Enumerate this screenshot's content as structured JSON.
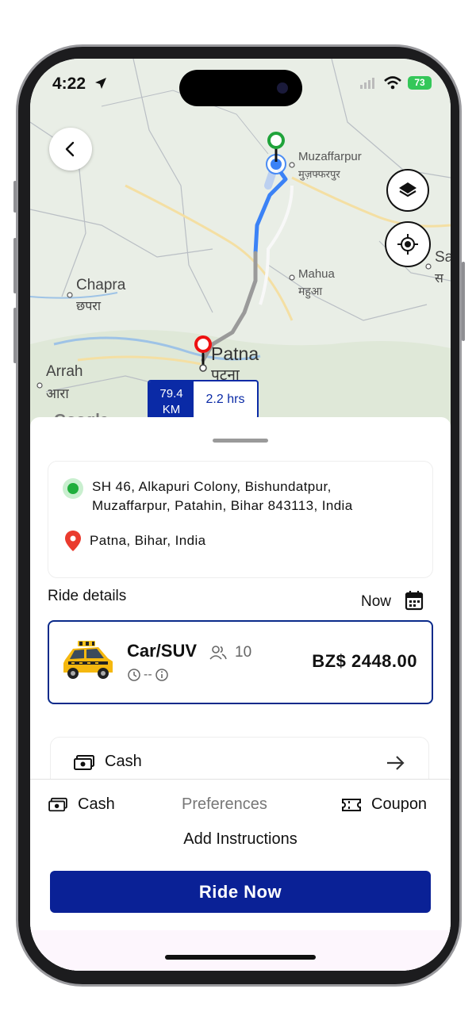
{
  "status_bar": {
    "time": "4:22",
    "battery": "73"
  },
  "map": {
    "labels": {
      "muzaffarpur_en": "Muzaffarpur",
      "muzaffarpur_hi": "मुज़फ्फरपुर",
      "chapra_en": "Chapra",
      "chapra_hi": "छपरा",
      "mahua_en": "Mahua",
      "mahua_hi": "महुआ",
      "patna_en": "Patna",
      "patna_hi": "पटना",
      "arrah_en": "Arrah",
      "arrah_hi": "आरा",
      "sa_en": "Sa",
      "sa_hi": "स",
      "google": "Google"
    },
    "distance_value": "79.4",
    "distance_unit": "KM",
    "duration": "2.2 hrs",
    "route_color": "#3b82f6"
  },
  "trip": {
    "pickup_line1": "SH 46, Alkapuri Colony, Bishundatpur,",
    "pickup_line2": "Muzaffarpur, Patahin, Bihar 843113, India",
    "dropoff": "Patna, Bihar, India"
  },
  "ride": {
    "section_title": "Ride details",
    "schedule_label": "Now",
    "vehicle_name": "Car/SUV",
    "seats": "10",
    "eta": "--",
    "price": "BZ$ 2448.00"
  },
  "payment": {
    "method": "Cash"
  },
  "options": {
    "cash_label": "Cash",
    "preferences_label": "Preferences",
    "coupon_label": "Coupon",
    "instructions_label": "Add Instructions"
  },
  "cta": {
    "label": "Ride Now",
    "color": "#0a2196"
  }
}
